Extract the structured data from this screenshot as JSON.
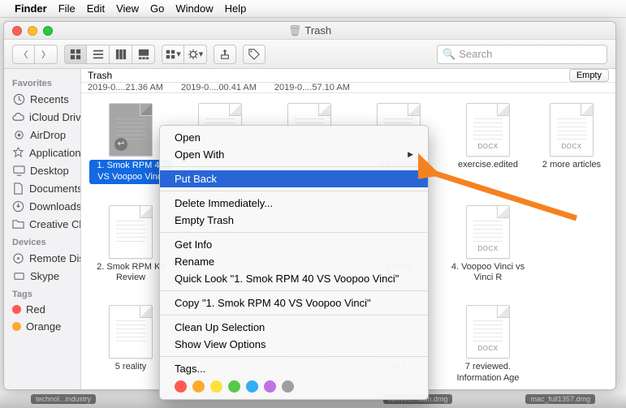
{
  "menubar": {
    "app": "Finder",
    "items": [
      "File",
      "Edit",
      "View",
      "Go",
      "Window",
      "Help"
    ]
  },
  "window": {
    "title": "Trash",
    "toolbar": {
      "search_placeholder": "Search"
    },
    "pathbar": {
      "location": "Trash",
      "empty": "Empty"
    },
    "column_headers": [
      "2019-0....21.36 AM",
      "2019-0....00.41 AM",
      "2019-0....57.10 AM"
    ]
  },
  "sidebar": {
    "sections": [
      {
        "title": "Favorites",
        "items": [
          {
            "icon": "clock-icon",
            "label": "Recents"
          },
          {
            "icon": "cloud-icon",
            "label": "iCloud Drive"
          },
          {
            "icon": "airdrop-icon",
            "label": "AirDrop"
          },
          {
            "icon": "app-icon",
            "label": "Applications"
          },
          {
            "icon": "desktop-icon",
            "label": "Desktop"
          },
          {
            "icon": "documents-icon",
            "label": "Documents"
          },
          {
            "icon": "downloads-icon",
            "label": "Downloads"
          },
          {
            "icon": "folder-icon",
            "label": "Creative Cl..."
          }
        ]
      },
      {
        "title": "Devices",
        "items": [
          {
            "icon": "disc-icon",
            "label": "Remote Disc"
          },
          {
            "icon": "skype-icon",
            "label": "Skype"
          }
        ]
      },
      {
        "title": "Tags",
        "items": [
          {
            "icon": "tag-red",
            "label": "Red"
          },
          {
            "icon": "tag-orange",
            "label": "Orange"
          }
        ]
      }
    ]
  },
  "files": {
    "row1": [
      {
        "name": "1. Smok RPM 40 VS Voopoo Vinci",
        "ext": "",
        "selected": true
      },
      {
        "name": "",
        "ext": ""
      },
      {
        "name": "",
        "ext": ""
      },
      {
        "name": "for edited",
        "ext": ""
      },
      {
        "name": "exercise.edited",
        "ext": "DOCX"
      },
      {
        "name": "2 more articles",
        "ext": "DOCX"
      }
    ],
    "row2": [
      {
        "name": "2. Smok RPM Kit Review",
        "ext": ""
      },
      {
        "name": "",
        "ext": ""
      },
      {
        "name": "",
        "ext": ""
      },
      {
        "name": "edited",
        "ext": ""
      },
      {
        "name": "4. Voopoo Vinci vs Vinci R",
        "ext": "DOCX"
      },
      {
        "name": "",
        "ext": ""
      }
    ],
    "row3": [
      {
        "name": "5 reality",
        "ext": ""
      },
      {
        "name": "",
        "ext": ""
      },
      {
        "name": "",
        "ext": ""
      },
      {
        "name": "in I",
        "ext": ""
      },
      {
        "name": "7 reviewed. Information Age",
        "ext": "DOCX"
      },
      {
        "name": "",
        "ext": ""
      }
    ]
  },
  "context_menu": {
    "open": "Open",
    "open_with": "Open With",
    "put_back": "Put Back",
    "delete": "Delete Immediately...",
    "empty": "Empty Trash",
    "get_info": "Get Info",
    "rename": "Rename",
    "quick_look": "Quick Look \"1. Smok RPM 40 VS Voopoo Vinci\"",
    "copy": "Copy \"1. Smok RPM 40 VS Voopoo Vinci\"",
    "cleanup": "Clean Up Selection",
    "view_opts": "Show View Options",
    "tags": "Tags...",
    "tag_colors": [
      "#ff5a52",
      "#fdab2f",
      "#fde13a",
      "#55c949",
      "#33aef2",
      "#c171e2",
      "#9e9e9e"
    ]
  },
  "dock": {
    "a": "technol...industry",
    "b": "convert...ition.dmg",
    "c": "mac_full1357.dmg"
  }
}
